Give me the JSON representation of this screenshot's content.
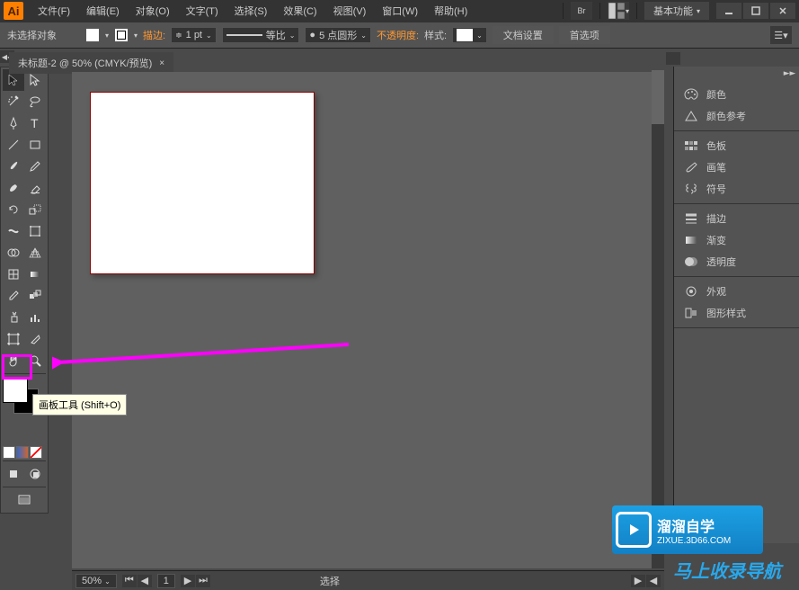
{
  "app": {
    "logo": "Ai"
  },
  "menu": {
    "file": "文件(F)",
    "edit": "编辑(E)",
    "object": "对象(O)",
    "type": "文字(T)",
    "select": "选择(S)",
    "effect": "效果(C)",
    "view": "视图(V)",
    "window": "窗口(W)",
    "help": "帮助(H)"
  },
  "workspace": {
    "label": "基本功能"
  },
  "options": {
    "noselection": "未选择对象",
    "stroke_lbl": "描边:",
    "stroke_val": "1 pt",
    "uniform": "等比",
    "pt_round": "5 点圆形",
    "opacity_lbl": "不透明度:",
    "style_lbl": "样式:",
    "docsetup": "文档设置",
    "prefs": "首选项"
  },
  "doc": {
    "tab": "未标题-2 @ 50% (CMYK/预览)",
    "close": "×"
  },
  "status": {
    "zoom": "50%",
    "page": "1",
    "label": "选择"
  },
  "tooltip": {
    "text": "画板工具 (Shift+O)"
  },
  "panels": {
    "color": "颜色",
    "color_guide": "颜色参考",
    "swatches": "色板",
    "brushes": "画笔",
    "symbols": "符号",
    "stroke": "描边",
    "gradient": "渐变",
    "transparency": "透明度",
    "appearance": "外观",
    "graphic_styles": "图形样式"
  },
  "wm": {
    "t1": "溜溜自学",
    "t2": "ZIXUE.3D66.COM",
    "sub": "马上收录导航"
  }
}
